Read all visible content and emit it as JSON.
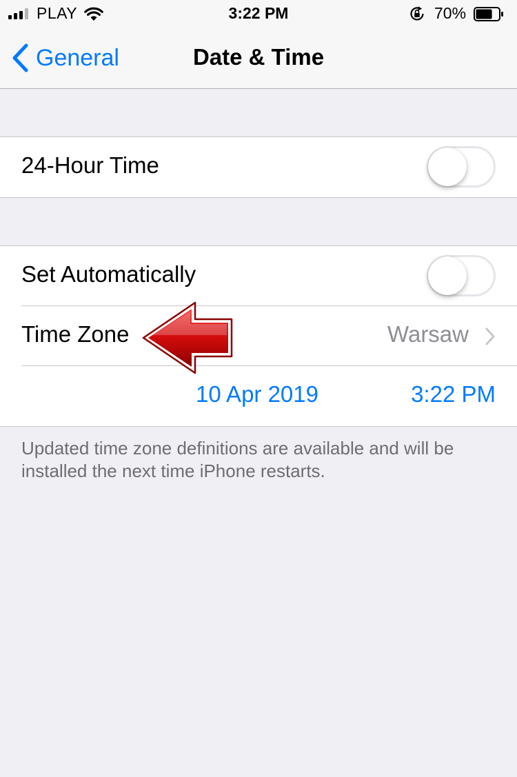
{
  "status_bar": {
    "carrier": "PLAY",
    "time": "3:22 PM",
    "battery_percent": "70%",
    "battery_level": 0.7,
    "signal_bars_active": 3,
    "signal_bars_total": 4,
    "icons": [
      "signal-icon",
      "wifi-icon",
      "orientation-lock-icon",
      "battery-icon"
    ]
  },
  "nav": {
    "back_label": "General",
    "title": "Date & Time",
    "back_icon": "chevron-left-icon"
  },
  "settings": {
    "hour24": {
      "label": "24-Hour Time",
      "enabled": false
    },
    "set_automatically": {
      "label": "Set Automatically",
      "enabled": false
    },
    "time_zone": {
      "label": "Time Zone",
      "value": "Warsaw",
      "icon": "chevron-right-icon"
    },
    "date": "10 Apr 2019",
    "time": "3:22 PM"
  },
  "annotation": {
    "icon": "red-arrow-icon",
    "color": "#d10b0b"
  },
  "footnote": "Updated time zone definitions are available and will be installed the next time iPhone restarts.",
  "colors": {
    "accent": "#007aff",
    "background": "#efeff4",
    "secondary_text": "#8e8e93",
    "footnote_text": "#6d6d72"
  }
}
